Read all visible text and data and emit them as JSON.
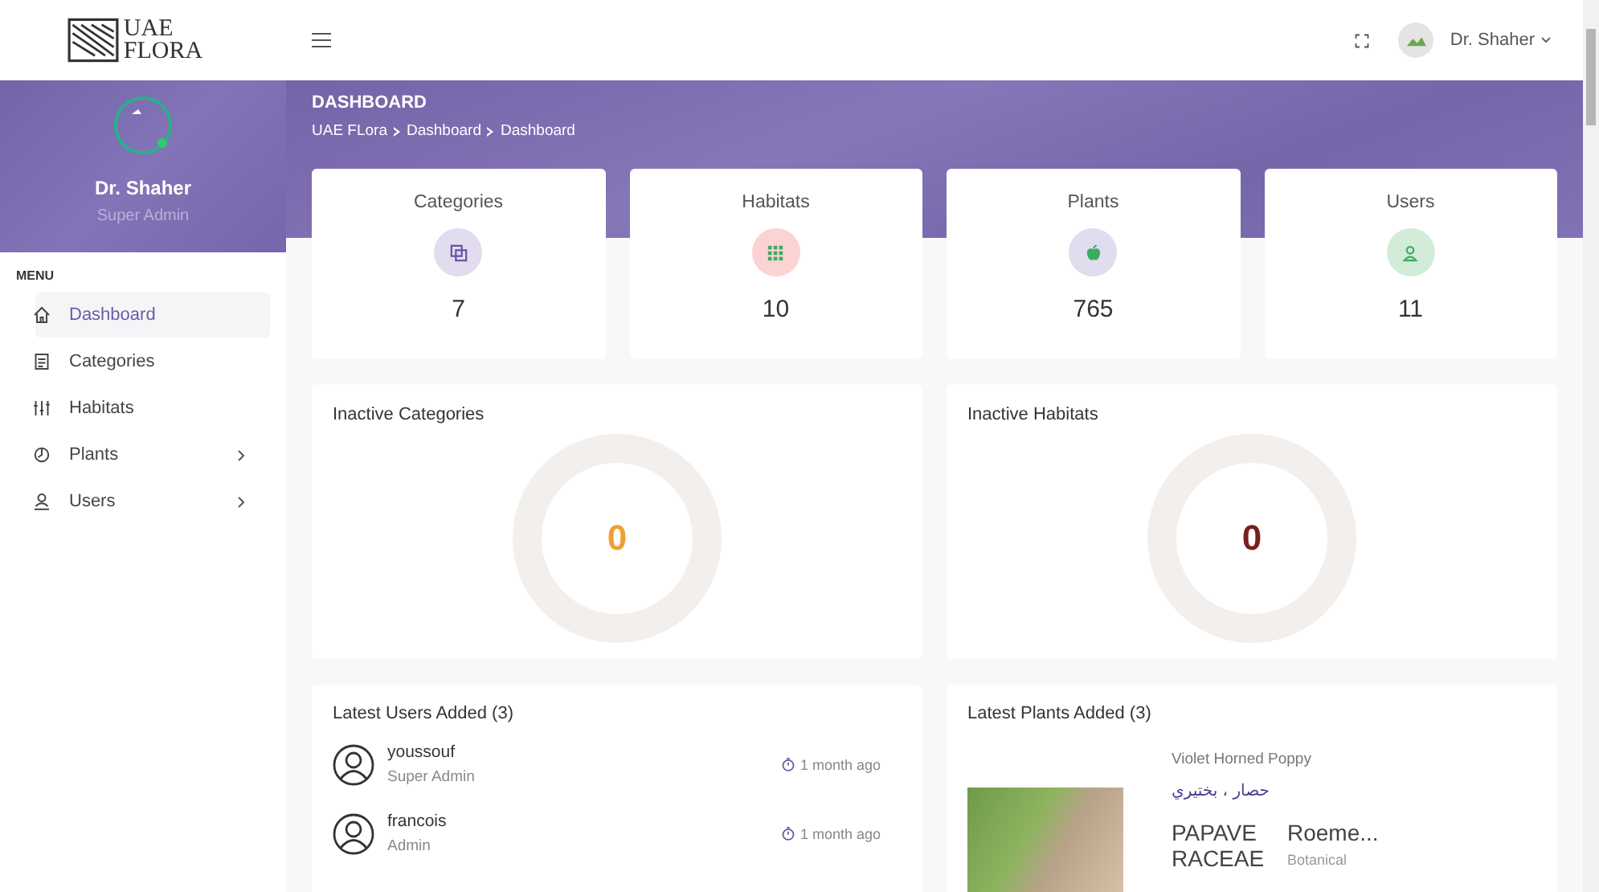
{
  "logo": {
    "line1": "UAE",
    "line2": "FLORA"
  },
  "topbar": {
    "user": "Dr. Shaher"
  },
  "profile": {
    "name": "Dr. Shaher",
    "role": "Super Admin"
  },
  "sidebar": {
    "heading": "MENU",
    "items": [
      {
        "label": "Dashboard",
        "kind": "home",
        "selected": true,
        "expandable": false
      },
      {
        "label": "Categories",
        "kind": "list",
        "selected": false,
        "expandable": false
      },
      {
        "label": "Habitats",
        "kind": "sliders",
        "selected": false,
        "expandable": false
      },
      {
        "label": "Plants",
        "kind": "plant",
        "selected": false,
        "expandable": true
      },
      {
        "label": "Users",
        "kind": "user",
        "selected": false,
        "expandable": true
      }
    ]
  },
  "page_header": {
    "title": "DASHBOARD",
    "breadcrumb": [
      "UAE FLora",
      "Dashboard",
      "Dashboard"
    ]
  },
  "stats": [
    {
      "label": "Categories",
      "value": "7",
      "kind": "copy"
    },
    {
      "label": "Habitats",
      "value": "10",
      "kind": "grid"
    },
    {
      "label": "Plants",
      "value": "765",
      "kind": "apple"
    },
    {
      "label": "Users",
      "value": "11",
      "kind": "user"
    }
  ],
  "donuts": [
    {
      "title": "Inactive Categories",
      "value": "0",
      "color": "#f0a030"
    },
    {
      "title": "Inactive Habitats",
      "value": "0",
      "color": "#7b1e1e"
    }
  ],
  "latest_users": {
    "title": "Latest Users Added (3)",
    "items": [
      {
        "name": "youssouf",
        "role": "Super Admin",
        "time": "1 month ago"
      },
      {
        "name": "francois",
        "role": "Admin",
        "time": "1 month ago"
      }
    ]
  },
  "latest_plants": {
    "title": "Latest Plants Added (3)",
    "items": [
      {
        "common_name": "Violet Horned Poppy",
        "arabic_name": "حصار ، بختيري",
        "family": "PAPAVERACEAE",
        "botanical": "Roeme...",
        "botanical_label": "Botanical"
      }
    ]
  }
}
